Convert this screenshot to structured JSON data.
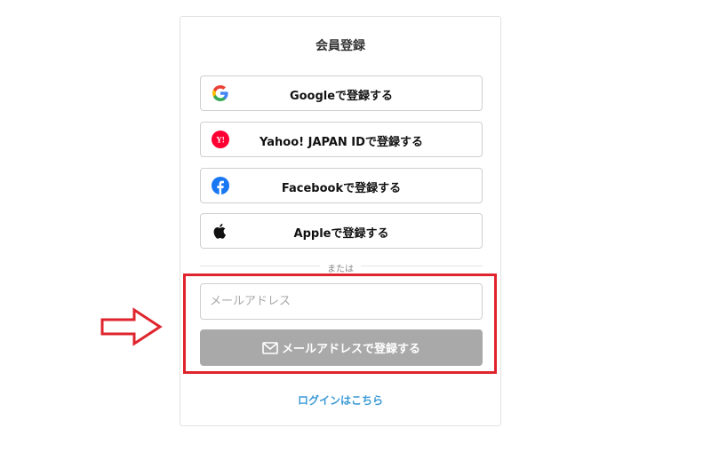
{
  "signup": {
    "title": "会員登録",
    "providers": [
      {
        "label": "Googleで登録する",
        "icon": "google-icon"
      },
      {
        "label": "Yahoo! JAPAN IDで登録する",
        "icon": "yahoo-japan-icon"
      },
      {
        "label": "Facebookで登録する",
        "icon": "facebook-icon"
      },
      {
        "label": "Appleで登録する",
        "icon": "apple-icon"
      }
    ],
    "divider_text": "または",
    "email_placeholder": "メールアドレス",
    "email_button_label": "メールアドレスで登録する",
    "login_link": "ログインはこちら"
  },
  "colors": {
    "button_disabled": "#a9a9a9",
    "link": "#3b9ad6",
    "annotation_red": "#e0242d",
    "facebook": "#1877f2",
    "yahoo": "#ff0033"
  }
}
